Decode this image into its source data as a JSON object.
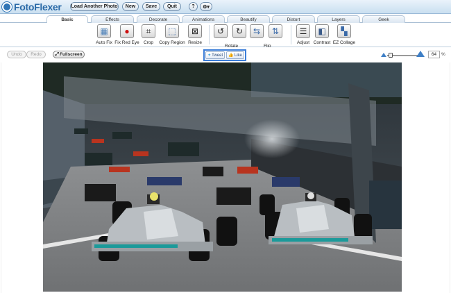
{
  "app": {
    "logo_text": "FotoFlexer"
  },
  "header": {
    "buttons": [
      {
        "label": "Load Another Photo"
      },
      {
        "label": "New"
      },
      {
        "label": "Save"
      },
      {
        "label": "Quit"
      }
    ],
    "help_label": "?",
    "settings_label": "⚙▾"
  },
  "tabs": [
    {
      "label": "Basic",
      "active": true
    },
    {
      "label": "Effects"
    },
    {
      "label": "Decorate"
    },
    {
      "label": "Animations"
    },
    {
      "label": "Beautify"
    },
    {
      "label": "Distort"
    },
    {
      "label": "Layers"
    },
    {
      "label": "Geek"
    }
  ],
  "tools": [
    {
      "label": "Auto Fix",
      "icon": "auto-fix-icon",
      "glyph": "▦"
    },
    {
      "label": "Fix Red Eye",
      "icon": "red-eye-icon",
      "glyph": "●"
    },
    {
      "label": "Crop",
      "icon": "crop-icon",
      "glyph": "⌗"
    },
    {
      "label": "Copy Region",
      "icon": "copy-region-icon",
      "glyph": "⬚"
    },
    {
      "label": "Resize",
      "icon": "resize-icon",
      "glyph": "⊠"
    },
    {
      "label": "Rotate",
      "icon": "rotate-left-icon",
      "glyph": "↺"
    },
    {
      "label": "",
      "icon": "rotate-right-icon",
      "glyph": "↻"
    },
    {
      "label": "",
      "icon": "flip-horizontal-icon",
      "glyph": "⇆"
    },
    {
      "label": "Flip",
      "icon": "flip-vertical-icon",
      "glyph": "⇅"
    },
    {
      "label": "Adjust",
      "icon": "adjust-icon",
      "glyph": "☰"
    },
    {
      "label": "Contrast",
      "icon": "contrast-icon",
      "glyph": "◧"
    },
    {
      "label": "EZ Collage",
      "icon": "collage-icon",
      "glyph": "▚"
    }
  ],
  "actions": {
    "undo": "Undo",
    "redo": "Redo",
    "fullscreen": "Fullscreen"
  },
  "social": {
    "tweet": "Tweet",
    "like": "Like"
  },
  "zoom": {
    "value": "64",
    "unit": "%",
    "level": 0.64
  },
  "colors": {
    "accent": "#2f74b5",
    "header_bg": "#c9dff0",
    "social_border": "#3b7dd8"
  }
}
